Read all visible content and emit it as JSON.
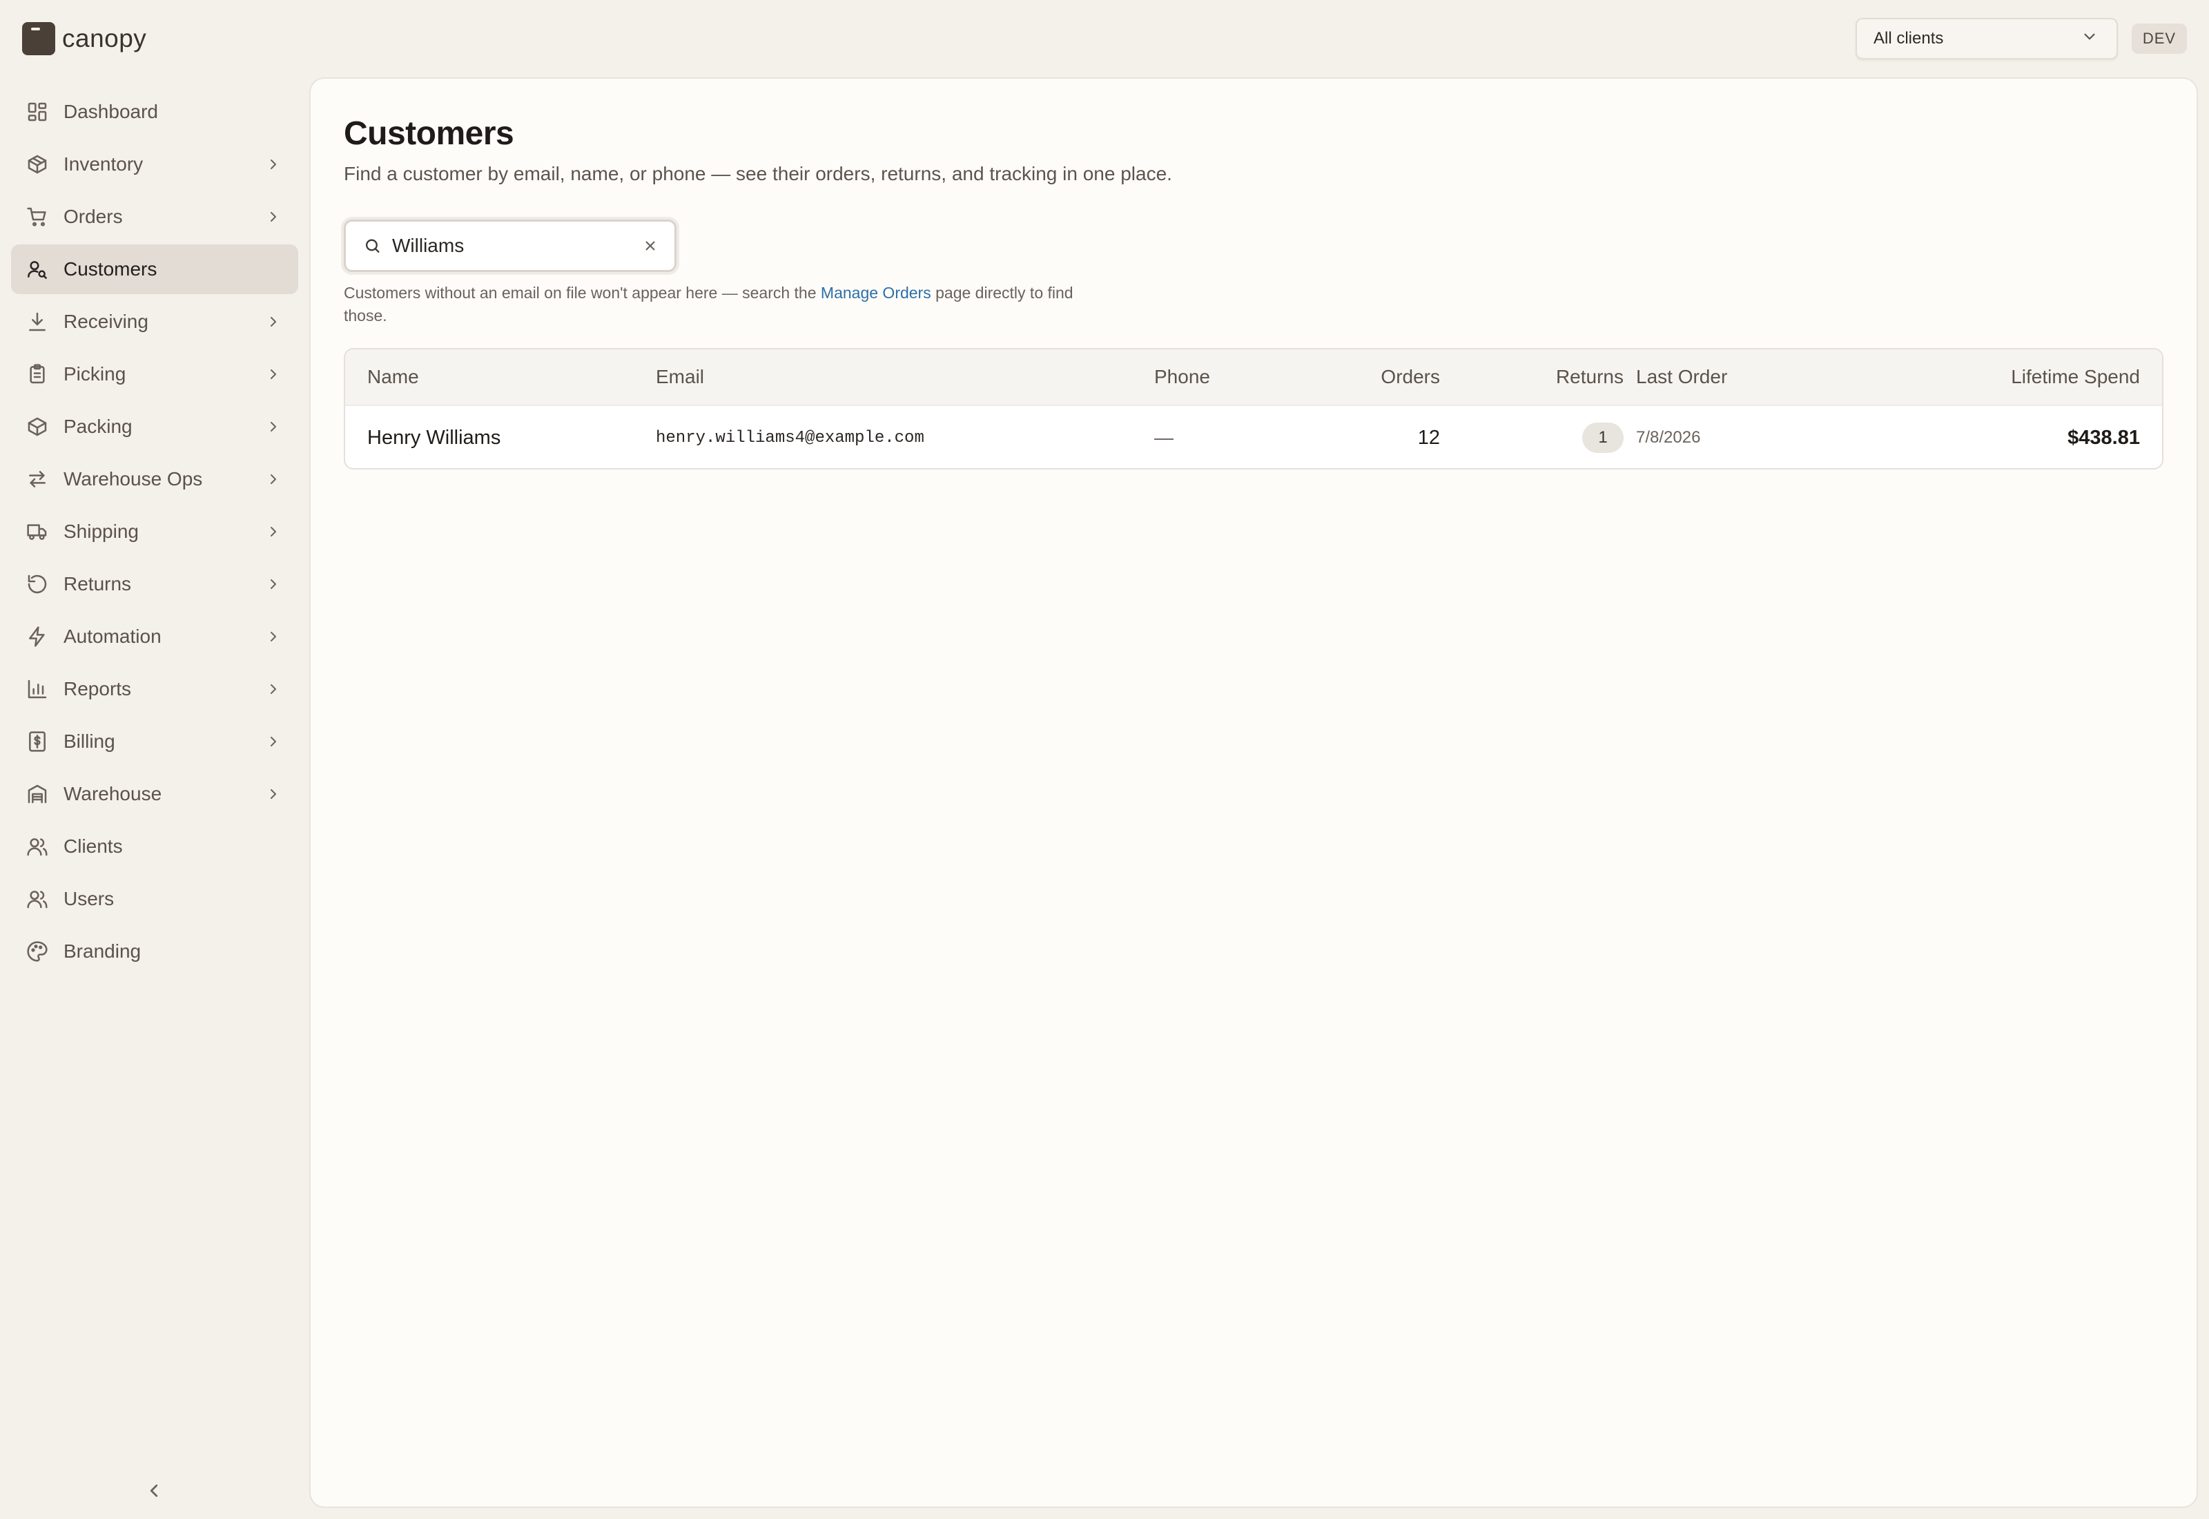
{
  "app": {
    "name": "canopy",
    "client_selector": "All clients",
    "env_badge": "DEV"
  },
  "sidebar": {
    "items": [
      {
        "label": "Dashboard",
        "icon": "dashboard-icon",
        "has_children": false,
        "active": false
      },
      {
        "label": "Inventory",
        "icon": "box-icon",
        "has_children": true,
        "active": false
      },
      {
        "label": "Orders",
        "icon": "cart-icon",
        "has_children": true,
        "active": false
      },
      {
        "label": "Customers",
        "icon": "user-search-icon",
        "has_children": false,
        "active": true
      },
      {
        "label": "Receiving",
        "icon": "download-icon",
        "has_children": true,
        "active": false
      },
      {
        "label": "Picking",
        "icon": "clipboard-icon",
        "has_children": true,
        "active": false
      },
      {
        "label": "Packing",
        "icon": "package-icon",
        "has_children": true,
        "active": false
      },
      {
        "label": "Warehouse Ops",
        "icon": "arrows-swap-icon",
        "has_children": true,
        "active": false
      },
      {
        "label": "Shipping",
        "icon": "truck-icon",
        "has_children": true,
        "active": false
      },
      {
        "label": "Returns",
        "icon": "rotate-ccw-icon",
        "has_children": true,
        "active": false
      },
      {
        "label": "Automation",
        "icon": "bolt-icon",
        "has_children": true,
        "active": false
      },
      {
        "label": "Reports",
        "icon": "bar-chart-icon",
        "has_children": true,
        "active": false
      },
      {
        "label": "Billing",
        "icon": "receipt-dollar-icon",
        "has_children": true,
        "active": false
      },
      {
        "label": "Warehouse",
        "icon": "warehouse-icon",
        "has_children": true,
        "active": false
      },
      {
        "label": "Clients",
        "icon": "users-icon",
        "has_children": false,
        "active": false
      },
      {
        "label": "Users",
        "icon": "users-icon",
        "has_children": false,
        "active": false
      },
      {
        "label": "Branding",
        "icon": "palette-icon",
        "has_children": false,
        "active": false
      }
    ]
  },
  "page": {
    "title": "Customers",
    "subtitle": "Find a customer by email, name, or phone — see their orders, returns, and tracking in one place."
  },
  "search": {
    "value": "Williams"
  },
  "help": {
    "before": "Customers without an email on file won't appear here — search the ",
    "link": "Manage Orders",
    "after": " page directly to find those."
  },
  "table": {
    "columns": [
      "Name",
      "Email",
      "Phone",
      "Orders",
      "Returns",
      "Last Order",
      "Lifetime Spend"
    ],
    "rows": [
      {
        "name": "Henry Williams",
        "email": "henry.williams4@example.com",
        "phone": "—",
        "orders": "12",
        "returns": "1",
        "last_order": "7/8/2026",
        "lifetime_spend": "$438.81"
      }
    ]
  },
  "colors": {
    "background": "#f4f0ea",
    "panel": "#fdfcf9",
    "active_nav": "#e2dcd5",
    "link": "#2f6fa8",
    "text": "#2a2623"
  }
}
